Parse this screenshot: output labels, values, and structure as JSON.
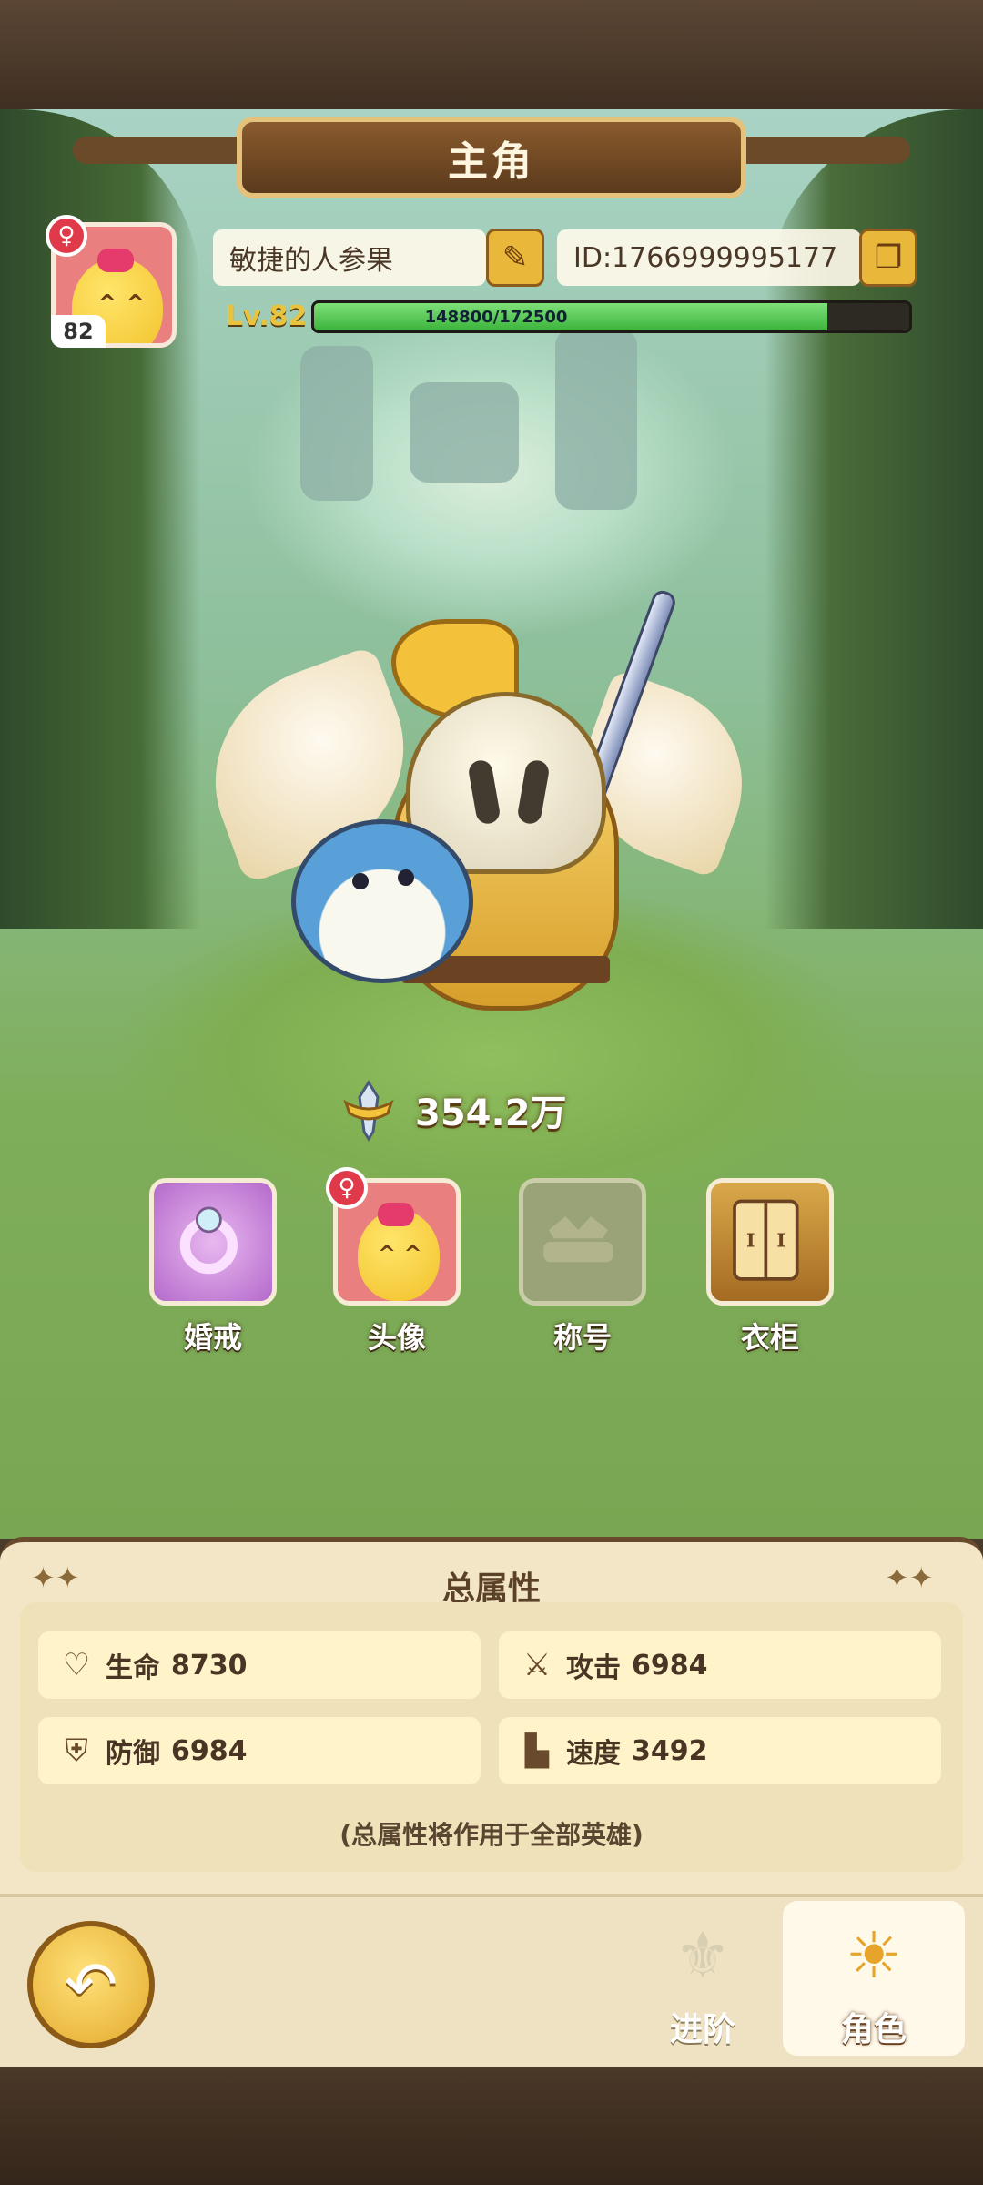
{
  "screen": {
    "title": "主角"
  },
  "profile": {
    "avatar_level": "82",
    "gender_symbol": "♀",
    "name": "敏捷的人参果",
    "id_text": "ID:1766999995177",
    "level_label": "Lv.82",
    "xp_current": 148800,
    "xp_max": 172500,
    "xp_text": "148800/172500"
  },
  "combat_power": "354.2万",
  "features": [
    {
      "label": "婚戒",
      "icon": "ring-icon"
    },
    {
      "label": "头像",
      "icon": "avatar-icon"
    },
    {
      "label": "称号",
      "icon": "title-icon"
    },
    {
      "label": "衣柜",
      "icon": "wardrobe-icon"
    }
  ],
  "attributes": {
    "title": "总属性",
    "stats": [
      {
        "icon": "heart-icon",
        "label": "生命",
        "value": "8730"
      },
      {
        "icon": "attack-icon",
        "label": "攻击",
        "value": "6984"
      },
      {
        "icon": "shield-icon",
        "label": "防御",
        "value": "6984"
      },
      {
        "icon": "boot-icon",
        "label": "速度",
        "value": "3492"
      }
    ],
    "note": "(总属性将作用于全部英雄)"
  },
  "nav": {
    "tabs": [
      {
        "label": "进阶",
        "icon": "advance-icon"
      },
      {
        "label": "角色",
        "icon": "character-icon"
      }
    ]
  },
  "colors": {
    "accent": "#e9b83b",
    "xp_bar": "#3bb43b",
    "panel": "#f2e6c6"
  }
}
